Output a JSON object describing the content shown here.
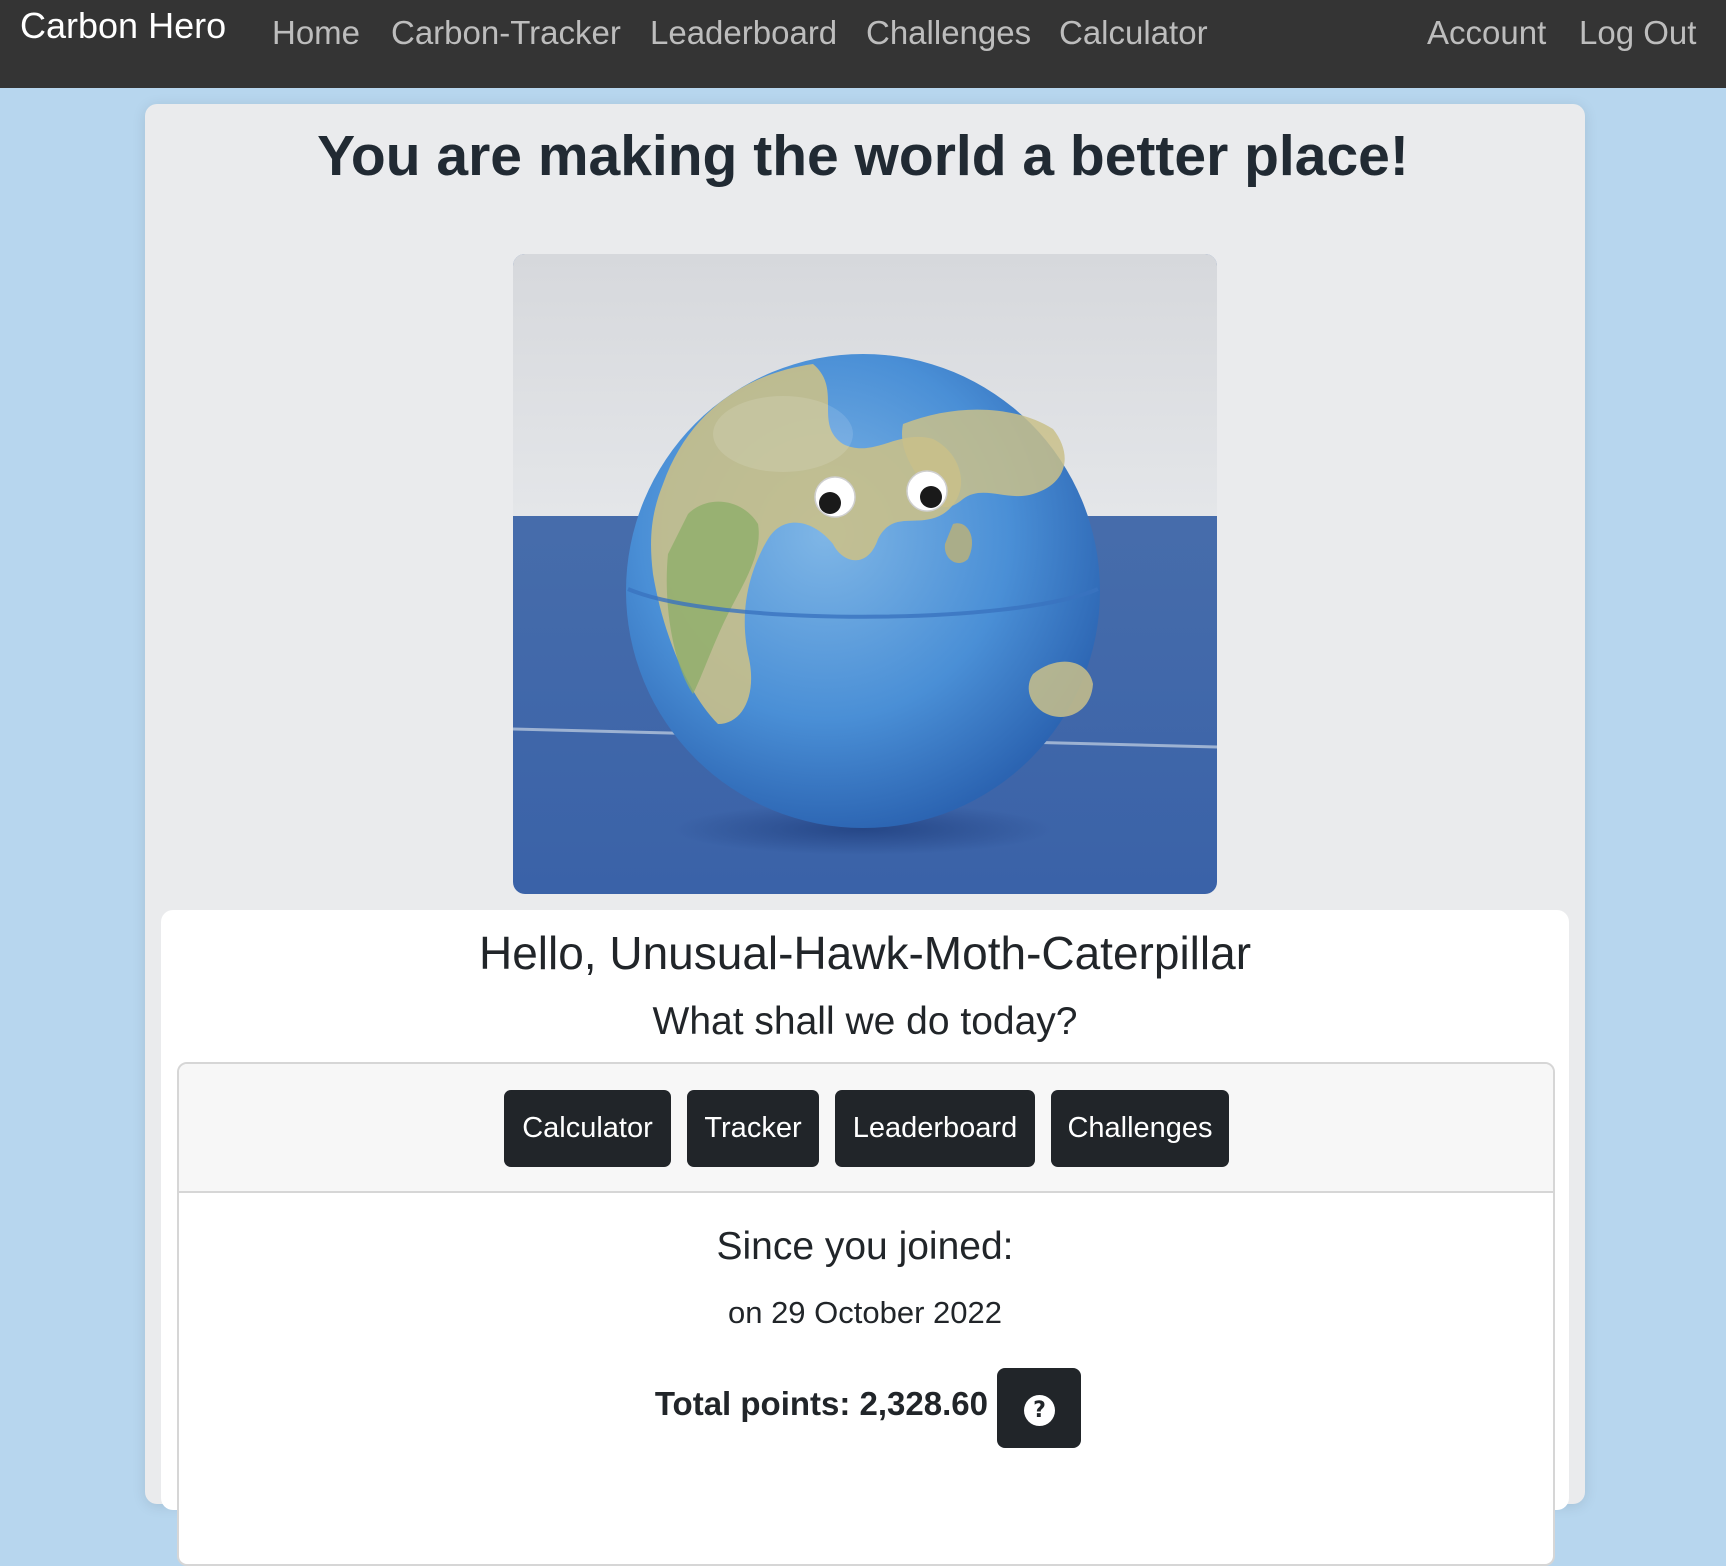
{
  "navbar": {
    "brand": "Carbon Hero",
    "links": [
      "Home",
      "Carbon-Tracker",
      "Leaderboard",
      "Challenges",
      "Calculator"
    ],
    "right_links": [
      "Account",
      "Log Out"
    ]
  },
  "hero": {
    "title": "You are making the world a better place!",
    "image_name": "globe-with-googly-eyes"
  },
  "welcome": {
    "greeting": "Hello, Unusual-Hawk-Moth-Caterpillar",
    "prompt": "What shall we do today?"
  },
  "actions": {
    "buttons": [
      "Calculator",
      "Tracker",
      "Leaderboard",
      "Challenges"
    ]
  },
  "stats": {
    "since_title": "Since you joined:",
    "joined_date": "on 29 October 2022",
    "total_points": "Total points: 2,328.60",
    "help_icon": "?"
  },
  "colors": {
    "page_bg": "#b7d6ee",
    "navbar_bg": "#343434",
    "button_bg": "#212529"
  }
}
